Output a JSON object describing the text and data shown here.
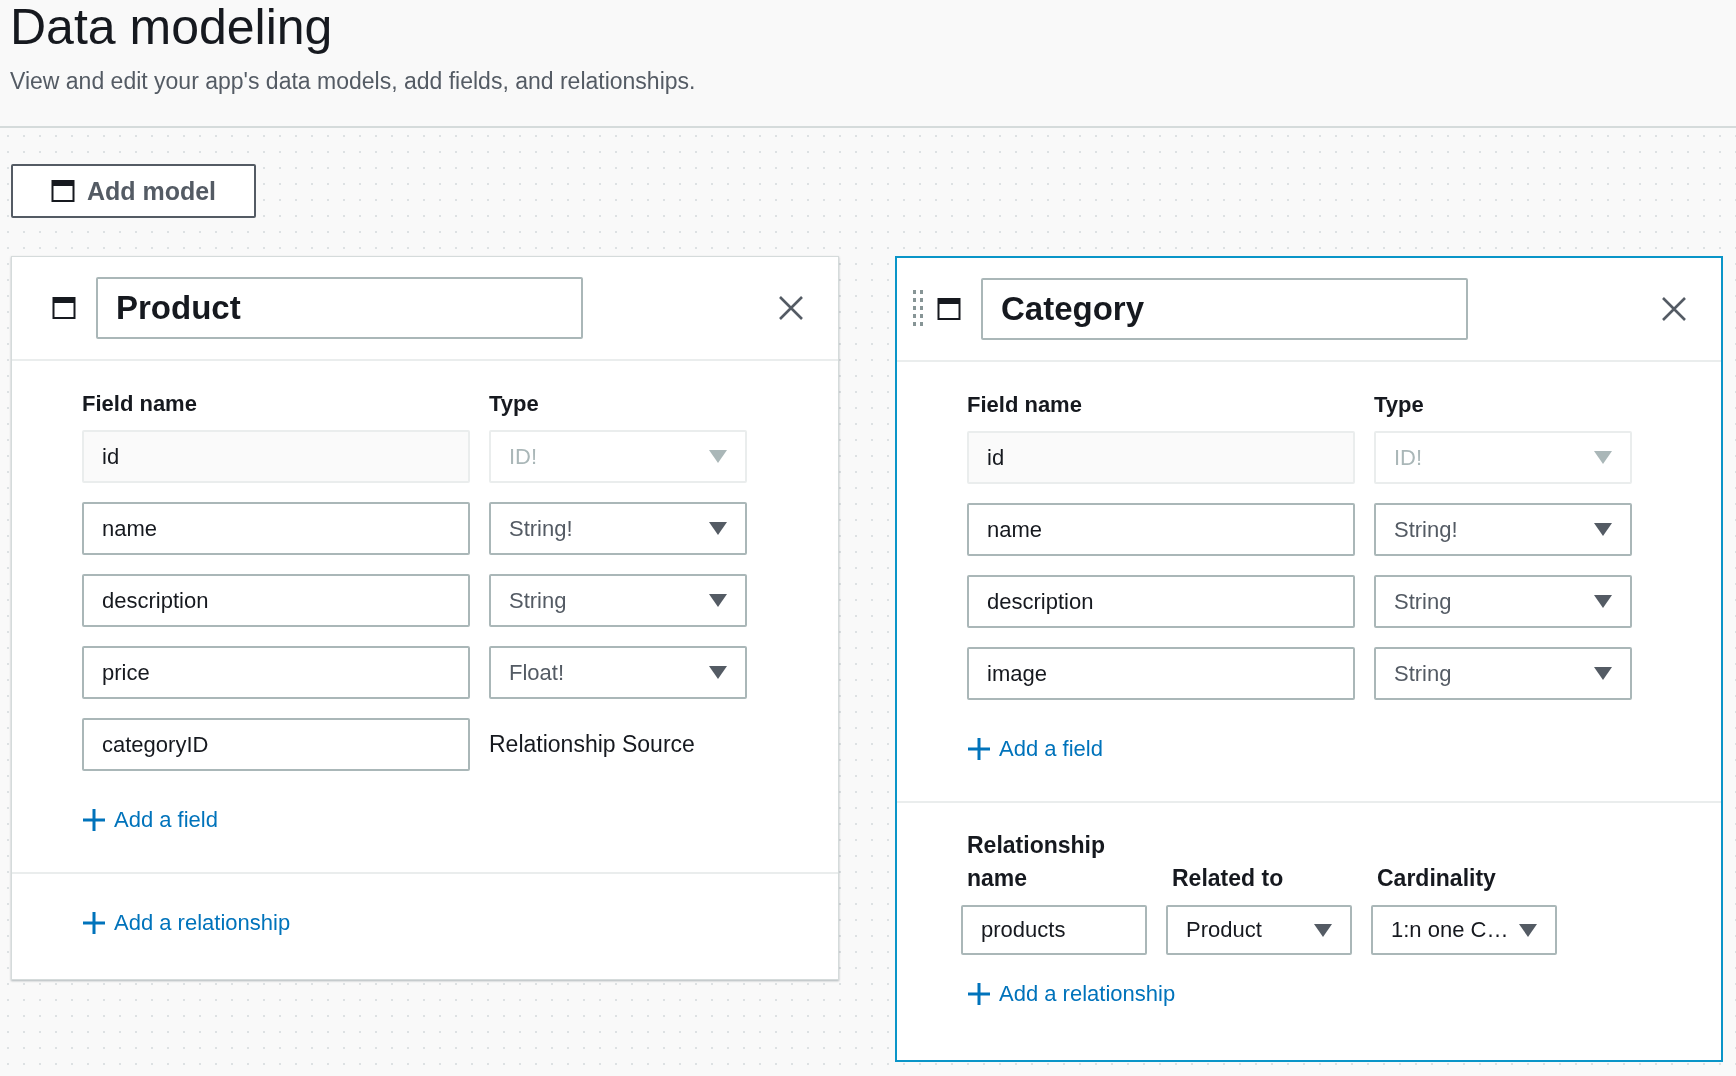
{
  "header": {
    "title": "Data modeling",
    "subtitle": "View and edit your app's data models, add fields, and relationships."
  },
  "add_model_button": "Add model",
  "models": [
    {
      "name": "Product",
      "selected": false,
      "drag_handle": false,
      "field_name_label": "Field name",
      "type_label": "Type",
      "fields": [
        {
          "name": "id",
          "kind": "select",
          "type": "ID!",
          "disabled": true
        },
        {
          "name": "name",
          "kind": "select",
          "type": "String!",
          "disabled": false
        },
        {
          "name": "description",
          "kind": "select",
          "type": "String",
          "disabled": false
        },
        {
          "name": "price",
          "kind": "select",
          "type": "Float!",
          "disabled": false
        },
        {
          "name": "categoryID",
          "kind": "text",
          "type": "Relationship Source",
          "disabled": false
        }
      ],
      "add_field": "Add a field",
      "add_relationship": "Add a relationship"
    },
    {
      "name": "Category",
      "selected": true,
      "drag_handle": true,
      "field_name_label": "Field name",
      "type_label": "Type",
      "fields": [
        {
          "name": "id",
          "kind": "select",
          "type": "ID!",
          "disabled": true
        },
        {
          "name": "name",
          "kind": "select",
          "type": "String!",
          "disabled": false
        },
        {
          "name": "description",
          "kind": "select",
          "type": "String",
          "disabled": false
        },
        {
          "name": "image",
          "kind": "select",
          "type": "String",
          "disabled": false
        }
      ],
      "add_field": "Add a field",
      "relationship_columns": [
        "Relationship name",
        "Related to",
        "Cardinality"
      ],
      "relationships": [
        {
          "name": "products",
          "related_to": "Product",
          "cardinality": "1:n one C…"
        }
      ],
      "add_relationship": "Add a relationship"
    }
  ]
}
